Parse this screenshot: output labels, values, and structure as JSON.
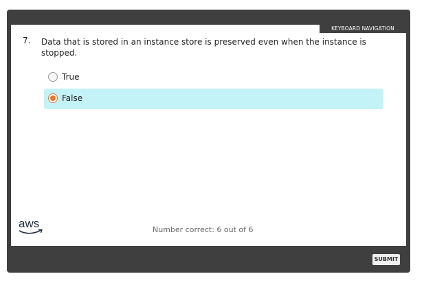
{
  "header": {
    "keyboard_navigation": "KEYBOARD NAVIGATION"
  },
  "question": {
    "number": "7.",
    "text": "Data that is stored in an instance store is preserved even when the instance is stopped."
  },
  "options": [
    {
      "label": "True",
      "selected": false
    },
    {
      "label": "False",
      "selected": true
    }
  ],
  "footer": {
    "logo_text": "aws",
    "score": "Number correct: 6 out of 6",
    "submit_label": "SUBMIT"
  },
  "colors": {
    "frame": "#3f3f3f",
    "selected_option_bg": "#c3f2f7",
    "radio_accent": "#e8762d"
  }
}
